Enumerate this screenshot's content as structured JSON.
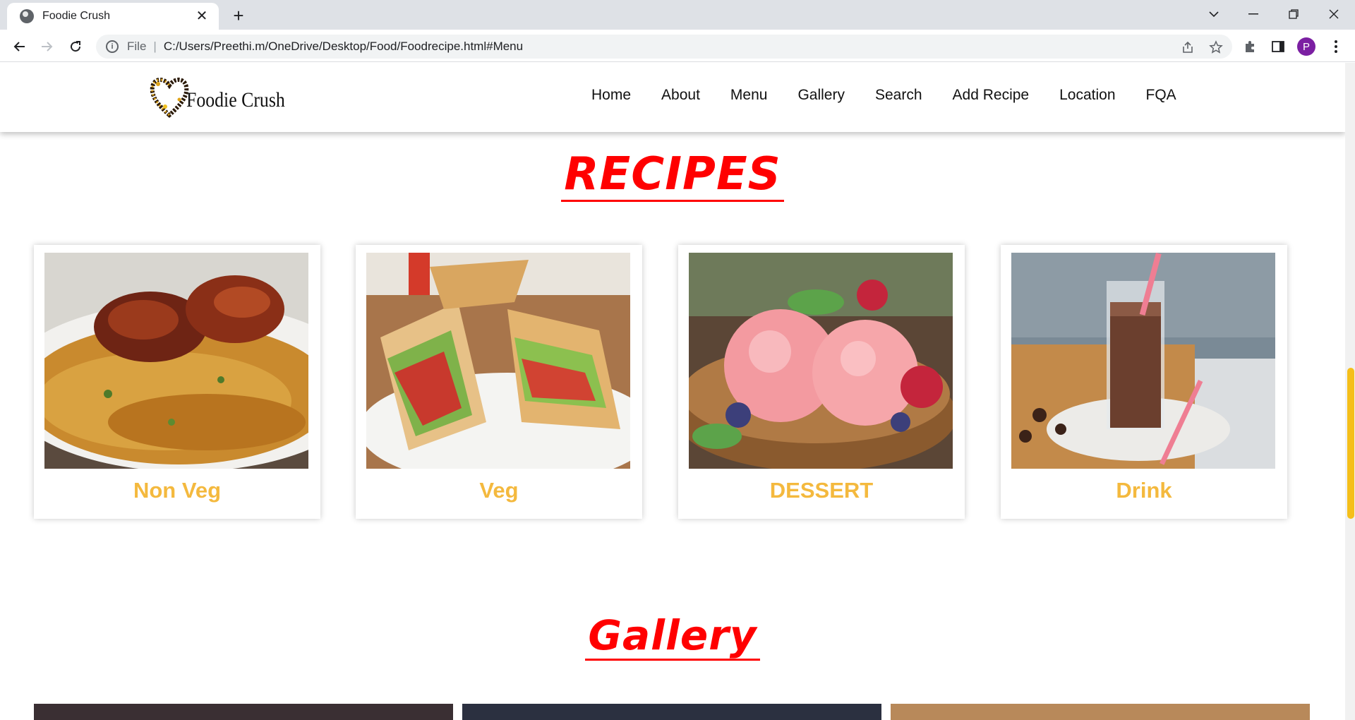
{
  "browser": {
    "tab_title": "Foodie Crush",
    "address_scheme": "File",
    "address_url": "C:/Users/Preethi.m/OneDrive/Desktop/Food/Foodrecipe.html#Menu",
    "profile_initial": "P"
  },
  "site": {
    "logo_text": "Foodie Crush",
    "nav": [
      "Home",
      "About",
      "Menu",
      "Gallery",
      "Search",
      "Add Recipe",
      "Location",
      "FQA"
    ]
  },
  "recipes": {
    "title": "RECIPES",
    "cards": [
      {
        "label": "Non Veg",
        "image": "chicken-biryani"
      },
      {
        "label": "Veg",
        "image": "club-sandwich"
      },
      {
        "label": "DESSERT",
        "image": "strawberry-ice-cream"
      },
      {
        "label": "Drink",
        "image": "chocolate-milkshake"
      }
    ]
  },
  "gallery": {
    "title": "Gallery"
  },
  "colors": {
    "heading_red": "#ff0000",
    "card_label": "#f4b93e",
    "scroll_thumb": "#f5bf1a"
  }
}
